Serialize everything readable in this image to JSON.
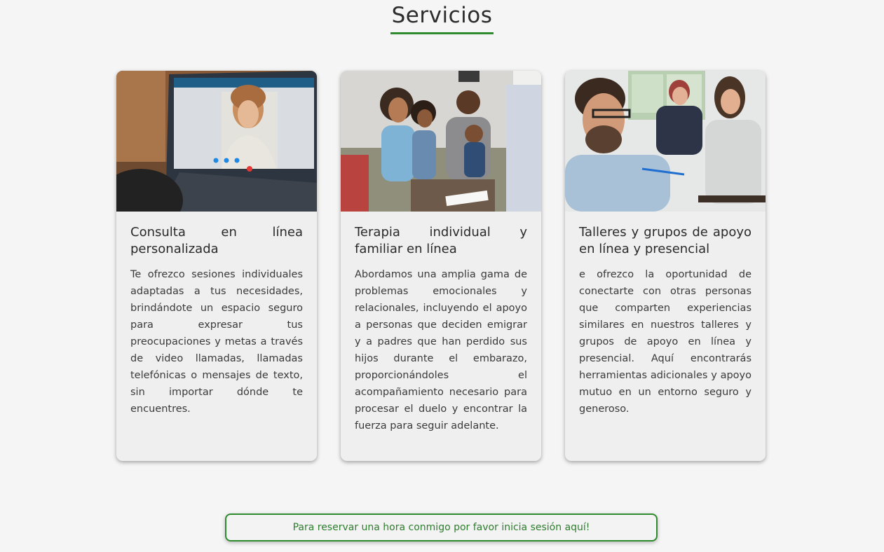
{
  "page": {
    "title": "Servicios"
  },
  "services": [
    {
      "image_name": "video-call-laptop-photo",
      "title": "Consulta en línea personalizada",
      "text": "Te ofrezco sesiones individuales adaptadas a tus necesidades, brindándote un espacio seguro para expresar tus preocupaciones y metas a través de video llamadas, llamadas telefónicas o mensajes de texto, sin importar dónde te encuentres."
    },
    {
      "image_name": "family-therapy-photo",
      "title": "Terapia individual y familiar en línea",
      "text": "Abordamos una amplia gama de problemas emocionales y relacionales, incluyendo el apoyo a personas que deciden emigrar y a padres que han perdido sus hijos durante el embarazo, proporcionándoles el acompañamiento necesario para procesar el duelo y encontrar la fuerza para seguir adelante."
    },
    {
      "image_name": "support-group-photo",
      "title": "Talleres y grupos de apoyo en línea y presencial",
      "text": "e ofrezco la oportunidad de conectarte con otras personas que comparten experiencias similares en nuestros talleres y grupos de apoyo en línea y presencial. Aquí encontrarás herramientas adicionales y apoyo mutuo en un entorno seguro y generoso."
    }
  ],
  "cta": {
    "label": "Para reservar una hora conmigo por favor inicia sesión aquí!"
  },
  "colors": {
    "accent": "#2e8b2e",
    "background": "#f5f5f5",
    "card": "#efefef"
  }
}
